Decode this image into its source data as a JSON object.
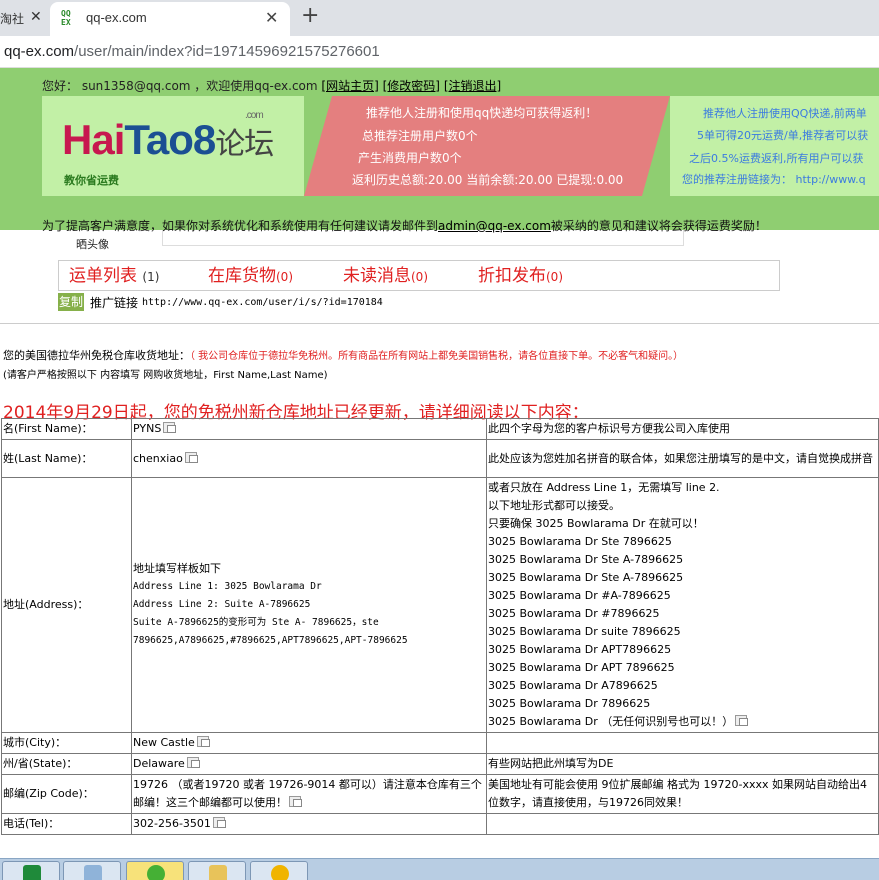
{
  "browser": {
    "prev_tab_label": "淘社",
    "tab_title": "qq-ex.com",
    "favicon_text": "QQ EX",
    "url_host": "qq-ex.com",
    "url_path": "/user/main/index?id=197145969215752766​01"
  },
  "header": {
    "greeting": "您好： sun1358@qq.com ，欢迎使用qq-ex.com",
    "links": [
      "[网站主页]",
      "[修改密码]",
      "[注销退出]"
    ],
    "logo_hai": "Hai",
    "logo_tao": "Tao",
    "logo_eight": "8",
    "logo_cn": "论坛",
    "logo_com": ".com",
    "logo_sub": "教你省运费",
    "pink_lines": [
      "推荐他人注册和使用qq快递均可获得返利！",
      "总推荐注册用户数0个",
      "产生消费用户数0个",
      "返利历史总额:20.00  当前余额:20.00  已提现:0.00"
    ],
    "right_lines": [
      "推荐他人注册使用QQ快递,前两单",
      "5单可得20元运费/单,推荐者可以获",
      "之后0.5%运费返利,所有用户可以获",
      "您的推荐注册链接为： http://www.q"
    ],
    "notice_prefix": "为了提高客户满意度，如果你对系统优化和系统使用有任何建议请发邮件到",
    "notice_email": "admin@qq-ex.com",
    "notice_suffix": "被采纳的意见和建议将会获得运费奖励！"
  },
  "account": {
    "avatar_label": "晒头像",
    "nav": [
      {
        "label": "运单列表",
        "count": "(1)"
      },
      {
        "label": "在库货物",
        "count": "(0)"
      },
      {
        "label": "未读消息",
        "count": "(0)"
      },
      {
        "label": "折扣发布",
        "count": "(0)"
      }
    ],
    "copy_button": "复制",
    "promo_label": "推广链接",
    "promo_link": "http://www.qq-ex.com/user/i/s/?id=170184"
  },
  "address_intro": {
    "line1": "您的美国德拉华州免税仓库收货地址：",
    "line1_red": "（ 我公司仓库位于德拉华免税州。所有商品在所有网站上都免美国销售税，请各位直接下单。不必客气和疑问。）",
    "line2": "(请客户严格按照以下 内容填写 网购收货地址，First Name,Last Name)",
    "title": "2014年9月29日起，您的免税州新仓库地址已经更新，请详细阅读以下内容："
  },
  "table": {
    "rows": [
      {
        "key": "名(First Name)：",
        "value": "PYNS",
        "note": "此四个字母为您的客户标识号方便我公司入库使用"
      },
      {
        "key": "姓(Last Name)：",
        "value": "chenxiao",
        "note": "此处应该为您姓加名拼音的联合体，如果您注册填写的是中文，请自觉换成拼音"
      },
      {
        "key": "城市(City)：",
        "value": "New Castle",
        "note": ""
      },
      {
        "key": "州/省(State)：",
        "value": "Delaware",
        "note": "有些网站把此州填写为DE"
      },
      {
        "key": "邮编(Zip Code)：",
        "value": "19726 （或者19720 或者 19726-9014 都可以）请注意本仓库有三个邮编！这三个邮编都可以使用！",
        "note": "美国地址有可能会使用 9位扩展邮编 格式为 19720-xxxx 如果网站自动给出4位数字，请直接使用，与19726同效果！"
      },
      {
        "key": "电话(Tel)：",
        "value": "302-256-3501",
        "note": ""
      }
    ],
    "address": {
      "key": "地址(Address)：",
      "template_title": "地址填写样板如下",
      "line1": "Address  Line  1: 3025  Bowlarama  Dr",
      "line2": "Address  Line  2:   Suite A-7896625",
      "variants": "Suite A-7896625的变形可为 Ste A- 7896625，ste 7896625,A7896625,#7896625,APT7896625,APT-7896625",
      "notes": [
        "或者只放在 Address Line 1，无需填写 line 2.",
        "以下地址形式都可以接受。",
        "只要确保 3025 Bowlarama Dr 在就可以！",
        "3025 Bowlarama Dr Ste 7896625",
        "3025 Bowlarama Dr Ste A-7896625",
        "3025 Bowlarama Dr Ste A-7896625",
        "3025 Bowlarama Dr #A-7896625",
        "3025 Bowlarama Dr #7896625",
        "3025 Bowlarama Dr suite 7896625",
        "3025 Bowlarama Dr APT7896625",
        "3025 Bowlarama Dr APT 7896625",
        "3025 Bowlarama Dr A7896625",
        "3025 Bowlarama Dr 7896625",
        "3025 Bowlarama Dr （无任何识别号也可以！）"
      ]
    }
  }
}
